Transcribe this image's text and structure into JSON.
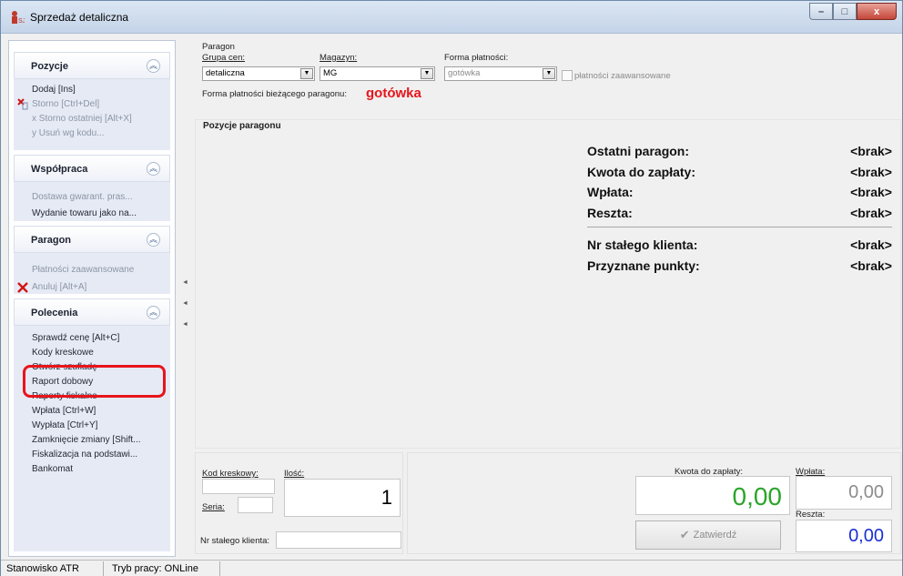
{
  "window": {
    "title": "Sprzedaż detaliczna",
    "minimize": "–",
    "maximize": "□",
    "close": "x"
  },
  "sidebar": {
    "groups": [
      {
        "title": "Pozycje",
        "items": [
          {
            "label": "Dodaj [Ins]",
            "disabled": false
          },
          {
            "label": "Storno [Ctrl+Del]",
            "disabled": true
          },
          {
            "label": "x Storno ostatniej [Alt+X]",
            "disabled": true
          },
          {
            "label": "y Usuń wg kodu...",
            "disabled": true
          }
        ]
      },
      {
        "title": "Współpraca",
        "items": [
          {
            "label": "Dostawa gwarant. pras...",
            "disabled": true
          },
          {
            "label": "Wydanie towaru jako na...",
            "disabled": false
          }
        ]
      },
      {
        "title": "Paragon",
        "items": [
          {
            "label": "Płatności zaawansowane",
            "disabled": true
          },
          {
            "label": "Anuluj [Alt+A]",
            "disabled": true
          }
        ]
      },
      {
        "title": "Polecenia",
        "items": [
          {
            "label": "Sprawdź cenę [Alt+C]",
            "disabled": false
          },
          {
            "label": "Kody kreskowe",
            "disabled": false
          },
          {
            "label": "Otwórz szufladę",
            "disabled": false
          },
          {
            "label": "Raport dobowy",
            "disabled": false
          },
          {
            "label": "Raporty fiskalne",
            "disabled": false
          },
          {
            "label": "Wpłata [Ctrl+W]",
            "disabled": false
          },
          {
            "label": "Wypłata [Ctrl+Y]",
            "disabled": false
          },
          {
            "label": "Zamknięcie zmiany [Shift...",
            "disabled": false
          },
          {
            "label": "Fiskalizacja na podstawi...",
            "disabled": false
          },
          {
            "label": "Bankomat",
            "disabled": false
          }
        ]
      }
    ]
  },
  "paragon": {
    "section_title": "Paragon",
    "grupa_cen_label": "Grupa cen:",
    "grupa_cen_value": "detaliczna",
    "magazyn_label": "Magazyn:",
    "magazyn_value": "MG",
    "forma_label": "Forma płatności:",
    "forma_value": "gotówka",
    "zaawansowane_label": "płatności zaawansowane",
    "biezaca_label": "Forma płatności bieżącego paragonu:",
    "biezaca_value": "gotówka"
  },
  "pozycje": {
    "title": "Pozycje paragonu",
    "summary": [
      {
        "label": "Ostatni paragon:",
        "value": "<brak>"
      },
      {
        "label": "Kwota do zapłaty:",
        "value": "<brak>"
      },
      {
        "label": "Wpłata:",
        "value": "<brak>"
      },
      {
        "label": "Reszta:",
        "value": "<brak>"
      },
      {
        "label": "Nr stałego klienta:",
        "value": "<brak>"
      },
      {
        "label": "Przyznane punkty:",
        "value": "<brak>"
      }
    ]
  },
  "bottom": {
    "kod_label": "Kod kreskowy:",
    "ilosc_label": "Ilość:",
    "ilosc_value": "1",
    "seria_label": "Seria:",
    "nr_klienta_label": "Nr stałego klienta:",
    "kwota_label": "Kwota do zapłaty:",
    "kwota_value": "0,00",
    "wplata_label": "Wpłata:",
    "wplata_value": "0,00",
    "reszta_label": "Reszta:",
    "reszta_value": "0,00",
    "zatwierdz_label": "Zatwierdź"
  },
  "status": {
    "stanowisko": "Stanowisko ATR",
    "tryb": "Tryb pracy: ONLine"
  },
  "colors": {
    "accent_red": "#e8141c",
    "kwota_green": "#2aa52a",
    "reszta_blue": "#1a2fd6"
  }
}
